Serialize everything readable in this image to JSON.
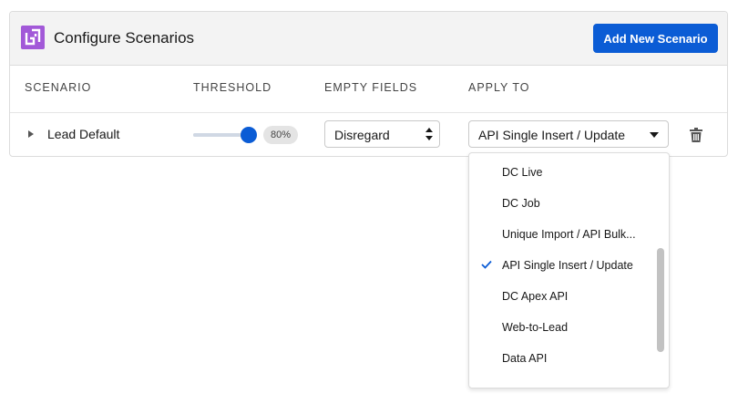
{
  "header": {
    "title": "Configure Scenarios",
    "add_button_label": "Add New Scenario",
    "logo_icon": "dc-logo-icon",
    "logo_color": "#a259d8"
  },
  "columns": {
    "scenario": "SCENARIO",
    "threshold": "THRESHOLD",
    "empty_fields": "EMPTY FIELDS",
    "apply_to": "APPLY TO"
  },
  "row": {
    "scenario_name": "Lead Default",
    "threshold_value": 0.8,
    "threshold_label": "80%",
    "empty_fields_value": "Disregard",
    "apply_to_value": "API Single Insert / Update",
    "delete_icon": "trash-icon"
  },
  "dropdown": {
    "options": [
      {
        "label": "DC Live",
        "selected": false
      },
      {
        "label": "DC Job",
        "selected": false
      },
      {
        "label": "Unique Import / API Bulk...",
        "selected": false
      },
      {
        "label": "API Single Insert / Update",
        "selected": true
      },
      {
        "label": "DC Apex API",
        "selected": false
      },
      {
        "label": "Web-to-Lead",
        "selected": false
      },
      {
        "label": "Data API",
        "selected": false
      }
    ]
  },
  "colors": {
    "accent": "#0b5cd5",
    "header_bg": "#f3f3f3",
    "border": "#dcdcdc"
  }
}
